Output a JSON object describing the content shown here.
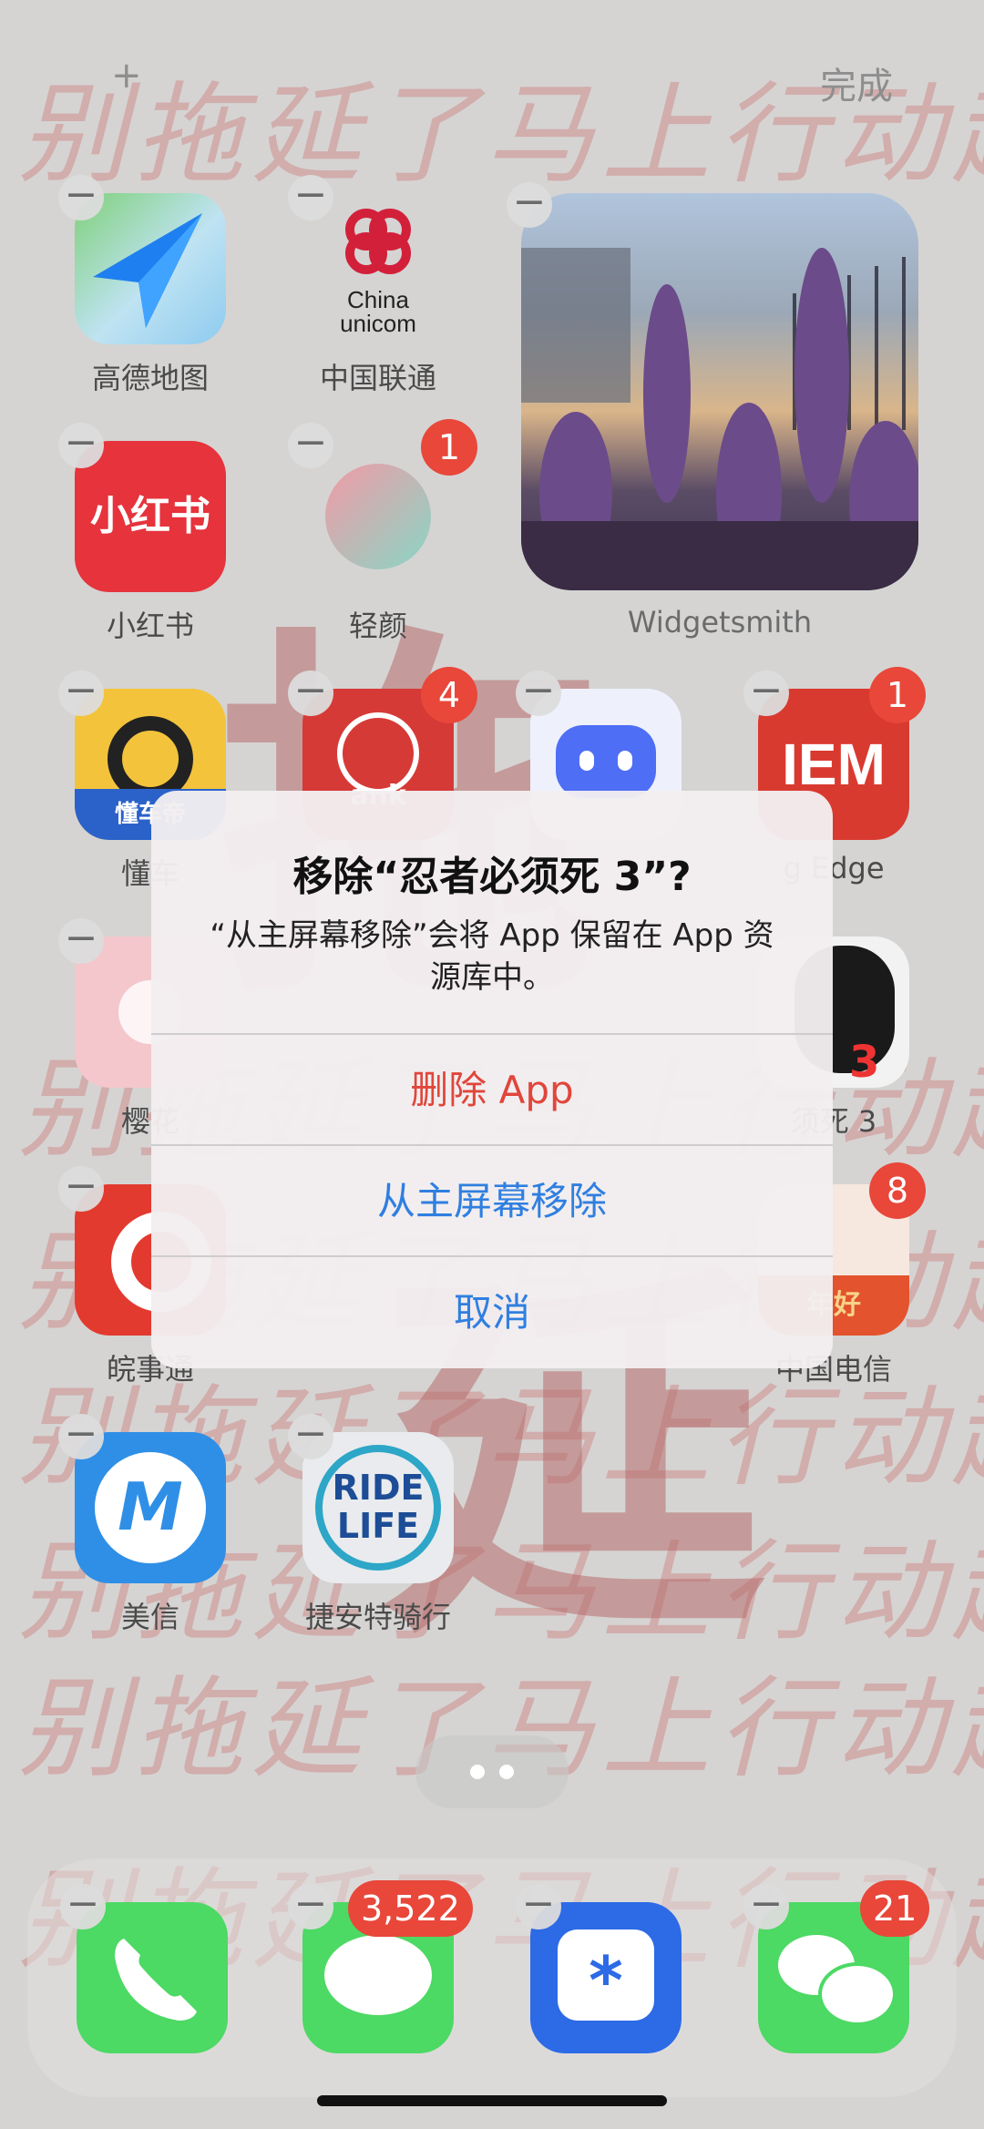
{
  "header": {
    "add_label": "+",
    "done_label": "完成"
  },
  "wallpaper": {
    "line_text": "别拖延了马上行动起来",
    "big_chars": [
      "拖",
      "延"
    ]
  },
  "apps": [
    {
      "label": "高德地图",
      "icon": "amap-icon"
    },
    {
      "label": "中国联通",
      "icon": "china-unicom-icon",
      "icon_text_1": "China",
      "icon_text_2": "unicom"
    },
    {
      "label": "小红书",
      "icon": "xiaohongshu-icon",
      "icon_text": "小红书"
    },
    {
      "label": "轻颜",
      "icon": "qingyan-icon",
      "badge": "1"
    },
    {
      "label": "懂车",
      "icon": "dongchedi-icon",
      "icon_text": "懂车帝"
    },
    {
      "label": "",
      "icon": "bank-icon",
      "badge": "4",
      "icon_text": "ank"
    },
    {
      "label": "",
      "icon": "blue-bot-icon"
    },
    {
      "label": "g Edge",
      "icon": "iem-icon",
      "badge": "1",
      "icon_text": "IEM"
    },
    {
      "label": "樱花",
      "icon": "sakura-icon"
    },
    {
      "label": "须死 3",
      "icon": "ninja-icon"
    },
    {
      "label": "皖事通",
      "icon": "wanshitong-icon"
    },
    {
      "label": "中国电信",
      "icon": "china-telecom-icon",
      "badge": "8",
      "icon_text": "年好"
    },
    {
      "label": "美信",
      "icon": "meixin-icon",
      "icon_text": "M"
    },
    {
      "label": "捷安特骑行",
      "icon": "ridelife-icon",
      "icon_text_1": "RIDE",
      "icon_text_2": "LIFE"
    }
  ],
  "widget": {
    "label": "Widgetsmith"
  },
  "dialog": {
    "title": "移除“忍者必须死 3”?",
    "message": "“从主屏幕移除”会将 App 保留在 App 资源库中。",
    "delete_label": "删除 App",
    "remove_label": "从主屏幕移除",
    "cancel_label": "取消",
    "colors": {
      "destructive": "#e0463a",
      "action": "#2f7fe0"
    }
  },
  "dock": [
    {
      "icon": "phone-icon"
    },
    {
      "icon": "messages-icon",
      "badge": "3,522"
    },
    {
      "icon": "dingtalk-like-icon"
    },
    {
      "icon": "wechat-icon",
      "badge": "21"
    }
  ]
}
